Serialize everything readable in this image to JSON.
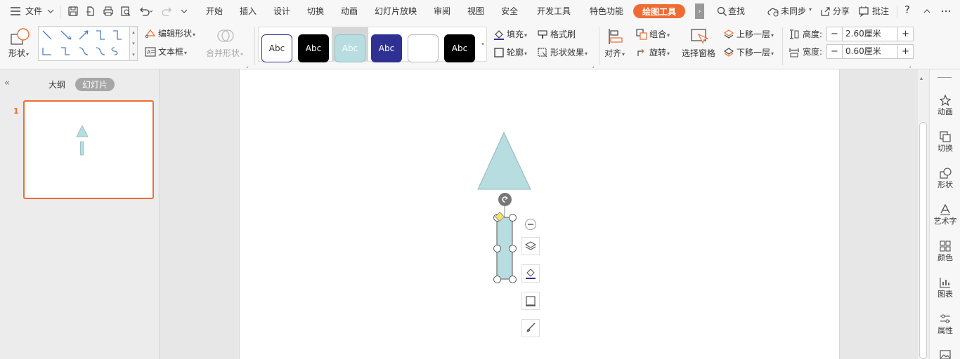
{
  "menu": {
    "file_label": "文件",
    "tabs": [
      "开始",
      "插入",
      "设计",
      "切换",
      "动画",
      "幻灯片放映",
      "审阅",
      "视图",
      "安全",
      "开发工具",
      "特色功能"
    ],
    "active_tab": "绘图工具",
    "search_label": "查找",
    "sync_label": "未同步",
    "share_label": "分享",
    "comment_label": "批注",
    "help_label": "?"
  },
  "ribbon": {
    "shape_label": "形状",
    "edit_shape_label": "编辑形状",
    "textbox_label": "文本框",
    "merge_shape_label": "合并形状",
    "style_swatches": [
      {
        "label": "Abc",
        "bg": "#ffffff",
        "fg": "#333333",
        "border": "#2e3192"
      },
      {
        "label": "Abc",
        "bg": "#000000",
        "fg": "#ffffff",
        "border": "#000000"
      },
      {
        "label": "Abc",
        "bg": "#b7dde0",
        "fg": "#ffffff",
        "border": "#8fc5ca"
      },
      {
        "label": "Abc",
        "bg": "#2e3192",
        "fg": "#ffffff",
        "border": "#2e3192"
      },
      {
        "label": "",
        "bg": "#ffffff",
        "fg": "#333333",
        "border": "#bbbbbb"
      },
      {
        "label": "Abc",
        "bg": "#000000",
        "fg": "#ffffff",
        "border": "#000000"
      }
    ],
    "fill_label": "填充",
    "format_brush_label": "格式刷",
    "outline_label": "轮廓",
    "shape_effect_label": "形状效果",
    "align_label": "对齐",
    "group_label": "组合",
    "rotate_label": "旋转",
    "selection_pane_label": "选择窗格",
    "bring_forward_label": "上移一层",
    "send_backward_label": "下移一层",
    "height_label": "高度:",
    "height_value": "2.60厘米",
    "width_label": "宽度:",
    "width_value": "0.60厘米",
    "minus": "−",
    "plus": "+"
  },
  "leftpanel": {
    "outline_tab": "大纲",
    "slides_tab": "幻灯片",
    "collapse_icon": "«",
    "slide_number": "1"
  },
  "rightbar": {
    "items": [
      "动画",
      "切换",
      "形状",
      "艺术字",
      "颜色",
      "图表",
      "属性"
    ]
  },
  "colors": {
    "accent": "#ee6c33",
    "shape_fill": "#b7dde0",
    "shape_stroke": "#8fb9bd",
    "handle_yellow": "#f4e36a"
  }
}
